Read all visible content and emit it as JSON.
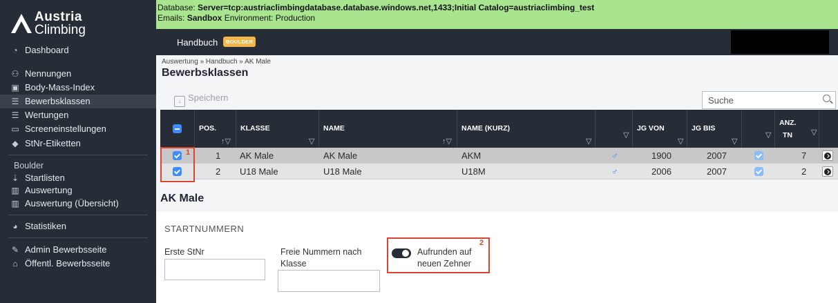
{
  "brand": {
    "line1": "Austria",
    "line2": "Climbing"
  },
  "sidebar": {
    "dashboard": {
      "label": "Dashboard",
      "icon": "dashboard-icon"
    },
    "items": [
      {
        "label": "Nennungen",
        "icon": "people-icon"
      },
      {
        "label": "Body-Mass-Index",
        "icon": "scale-icon"
      },
      {
        "label": "Bewerbsklassen",
        "icon": "list-icon",
        "active": true
      },
      {
        "label": "Wertungen",
        "icon": "list-icon"
      },
      {
        "label": "Screeneinstellungen",
        "icon": "monitor-icon"
      },
      {
        "label": "StNr-Etiketten",
        "icon": "tag-icon"
      }
    ],
    "section_boulder": "Boulder",
    "boulder_items": [
      {
        "label": "Startlisten",
        "icon": "sort-icon"
      },
      {
        "label": "Auswertung",
        "icon": "ranking-icon"
      },
      {
        "label": "Auswertung (Übersicht)",
        "icon": "ranking-icon"
      }
    ],
    "statistiken": {
      "label": "Statistiken",
      "icon": "chart-icon"
    },
    "admin": {
      "label": "Admin Bewerbsseite",
      "icon": "edit-icon"
    },
    "public": {
      "label": "Öffentl. Bewerbsseite",
      "icon": "home-icon"
    }
  },
  "env": {
    "db_prefix": "Database: ",
    "db_value": "Server=tcp:austriaclimbingdatabase.database.windows.net,1433;Initial Catalog=austriaclimbing_test",
    "emails_prefix": "Emails: ",
    "emails_value": "Sandbox",
    "env_text": " Environment: Production",
    "color": "#a9e58f"
  },
  "topnav": {
    "handbuch": "Handbuch",
    "badge": "BOULDER"
  },
  "page": {
    "breadcrumb": "Auswertung » Handbuch » AK Male",
    "title": "Bewerbsklassen",
    "save_label": "Speichern",
    "search_placeholder": "Suche"
  },
  "table": {
    "columns": {
      "pos": "POS.",
      "klasse": "KLASSE",
      "name": "NAME",
      "name_kurz": "NAME (KURZ)",
      "jg_von": "JG VON",
      "jg_bis": "JG BIS",
      "anz_tn_1": "ANZ.",
      "anz_tn_2": "TN"
    },
    "rows": [
      {
        "pos": "1",
        "klasse": "AK Male",
        "name": "AK Male",
        "kurz": "AKM",
        "gender": "♂",
        "jg_von": "1900",
        "jg_bis": "2007",
        "anz": "7"
      },
      {
        "pos": "2",
        "klasse": "U18 Male",
        "name": "U18 Male",
        "kurz": "U18M",
        "gender": "♂",
        "jg_von": "2006",
        "jg_bis": "2007",
        "anz": "2"
      }
    ]
  },
  "annotations": {
    "n1": "1",
    "n2": "2",
    "color": "#d9432f"
  },
  "detail": {
    "title": "AK Male",
    "section": "STARTNUMMERN",
    "erste_stnr": "Erste StNr",
    "freie_1": "Freie Nummern nach",
    "freie_2": "Klasse",
    "aufrunden_1": "Aufrunden auf",
    "aufrunden_2": "neuen Zehner"
  }
}
